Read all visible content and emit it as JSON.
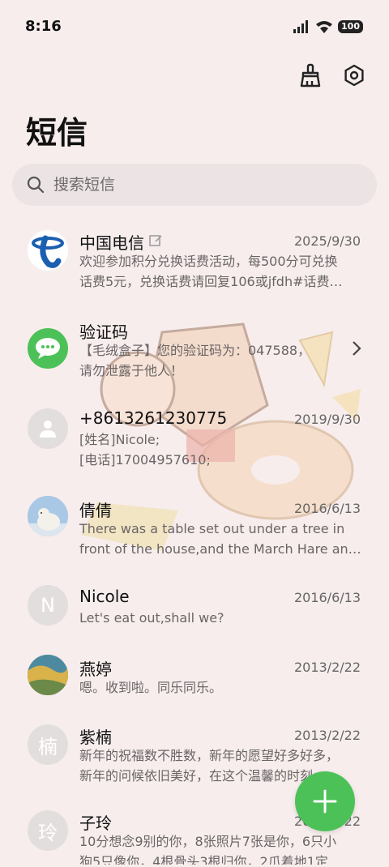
{
  "status_bar": {
    "time": "8:16",
    "battery": "100"
  },
  "toolbar": {
    "clean_icon": "broom-icon",
    "settings_icon": "settings-icon"
  },
  "header": {
    "title": "短信"
  },
  "search": {
    "placeholder": "搜索短信"
  },
  "messages": [
    {
      "name": "中国电信",
      "date": "2025/9/30",
      "line1": "欢迎参加积分兑换话费活动，每500分可兑换",
      "line2": "话费5元，兑换话费请回复106或jfdh#话费…",
      "avatar": "china-telecom-logo"
    },
    {
      "name": "验证码",
      "date": "",
      "line1": "【毛绒盒子】您的验证码为：047588，",
      "line2": "请勿泄露于他人！",
      "avatar": "message-bubble-icon"
    },
    {
      "name": "+8613261230775",
      "date": "2019/9/30",
      "line1": "[姓名]Nicole;",
      "line2": "[电话]17004957610;",
      "avatar": "person-icon"
    },
    {
      "name": "倩倩",
      "date": "2016/6/13",
      "line1": "There was a table set out under a tree in",
      "line2": "front of the house,and the March Hare an…",
      "avatar": "polar-bear-photo"
    },
    {
      "name": "Nicole",
      "date": "2016/6/13",
      "line1": "Let's eat out,shall we?",
      "line2": "",
      "avatar_letter": "N"
    },
    {
      "name": "燕婷",
      "date": "2013/2/22",
      "line1": "嗯。收到啦。同乐同乐。",
      "line2": "",
      "avatar": "ocean-photo"
    },
    {
      "name": "紫楠",
      "date": "2013/2/22",
      "line1": "新年的祝福数不胜数，新年的愿望好多好多，",
      "line2": "新年的问候依旧美好，在这个温馨的时刻…",
      "avatar_letter": "楠"
    },
    {
      "name": "子玲",
      "date": "2013/2/22",
      "line1": "10分想念9别的你，8张照片7张是你，6只小",
      "line2": "狗5只像你，4根骨头3根归你，2爪着地1定…",
      "avatar_letter": "玲"
    }
  ],
  "fab": {
    "icon": "plus-icon"
  },
  "colors": {
    "background": "#f7eded",
    "accent": "#4cc158",
    "telecom_blue": "#1b5fb0"
  }
}
